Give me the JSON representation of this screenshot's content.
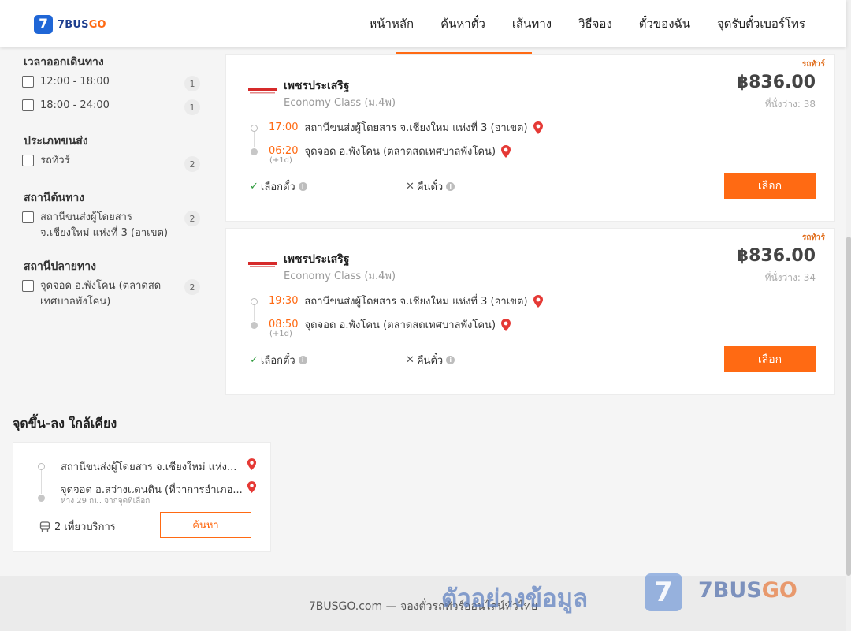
{
  "brand": {
    "logo_glyph": "7",
    "name_a": "7BUS",
    "name_b": "GO",
    "accent": "#ff6a13",
    "blue": "#1f66d6"
  },
  "nav": [
    "หน้าหลัก",
    "ค้นหาตั๋ว",
    "เส้นทาง",
    "วิธีจอง",
    "ตั๋วของฉัน",
    "จุดรับตั๋วเบอร์โทร"
  ],
  "filters": {
    "departure_title": "เวลาออกเดินทาง",
    "departure": [
      {
        "label": "12:00 - 18:00",
        "count": "1"
      },
      {
        "label": "18:00 - 24:00",
        "count": "1"
      }
    ],
    "type_title": "ประเภทขนส่ง",
    "type": [
      {
        "label": "รถทัวร์",
        "count": "2"
      }
    ],
    "origin_title": "สถานีต้นทาง",
    "origin": [
      {
        "label": "สถานีขนส่งผู้โดยสาร จ.เชียงใหม่ แห่งที่ 3 (อาเขต)",
        "count": "2"
      }
    ],
    "dest_title": "สถานีปลายทาง",
    "dest": [
      {
        "label": "จุดจอด อ.พังโคน (ตลาดสดเทศบาลพังโคน)",
        "count": "2"
      }
    ]
  },
  "trips": [
    {
      "badge": "รถทัวร์",
      "operator": "เพชรประเสริฐ",
      "class": "Economy Class (ม.4พ)",
      "price": "฿836.00",
      "seats": "ที่นั่งว่าง: 38",
      "dep_time": "17:00",
      "dep_stop": "สถานีขนส่งผู้โดยสาร จ.เชียงใหม่ แห่งที่ 3 (อาเขต)",
      "arr_time": "06:20",
      "arr_stop": "จุดจอด อ.พังโคน (ตลาดสดเทศบาลพังโคน)",
      "plus_day": "(+1d)",
      "seat_select": "เลือกตั๋ว",
      "refund": "คืนตั๋ว",
      "select": "เลือก"
    },
    {
      "badge": "รถทัวร์",
      "operator": "เพชรประเสริฐ",
      "class": "Economy Class (ม.4พ)",
      "price": "฿836.00",
      "seats": "ที่นั่งว่าง: 34",
      "dep_time": "19:30",
      "dep_stop": "สถานีขนส่งผู้โดยสาร จ.เชียงใหม่ แห่งที่ 3 (อาเขต)",
      "arr_time": "08:50",
      "arr_stop": "จุดจอด อ.พังโคน (ตลาดสดเทศบาลพังโคน)",
      "plus_day": "(+1d)",
      "seat_select": "เลือกตั๋ว",
      "refund": "คืนตั๋ว",
      "select": "เลือก"
    }
  ],
  "nearby": {
    "title": "จุดขึ้น-ลง ใกล้เคียง",
    "from": "สถานีขนส่งผู้โดยสาร จ.เชียงใหม่ แห่ง...",
    "to": "จุดจอด อ.สว่างแดนดิน (ที่ว่าการอำเภอ...",
    "distance": "ห่าง 29 กม. จากจุดที่เลือก",
    "trips": "2 เที่ยวบริการ",
    "search": "ค้นหา"
  },
  "footer": {
    "text": "7BUSGO.com — จองตั๋วรถทัวร์ออนไลน์ทั่วไทย"
  },
  "watermark": {
    "text": "ตัวอย่างข้อมูล",
    "glyph": "7",
    "brand_a": "7BUS",
    "brand_b": "GO"
  }
}
